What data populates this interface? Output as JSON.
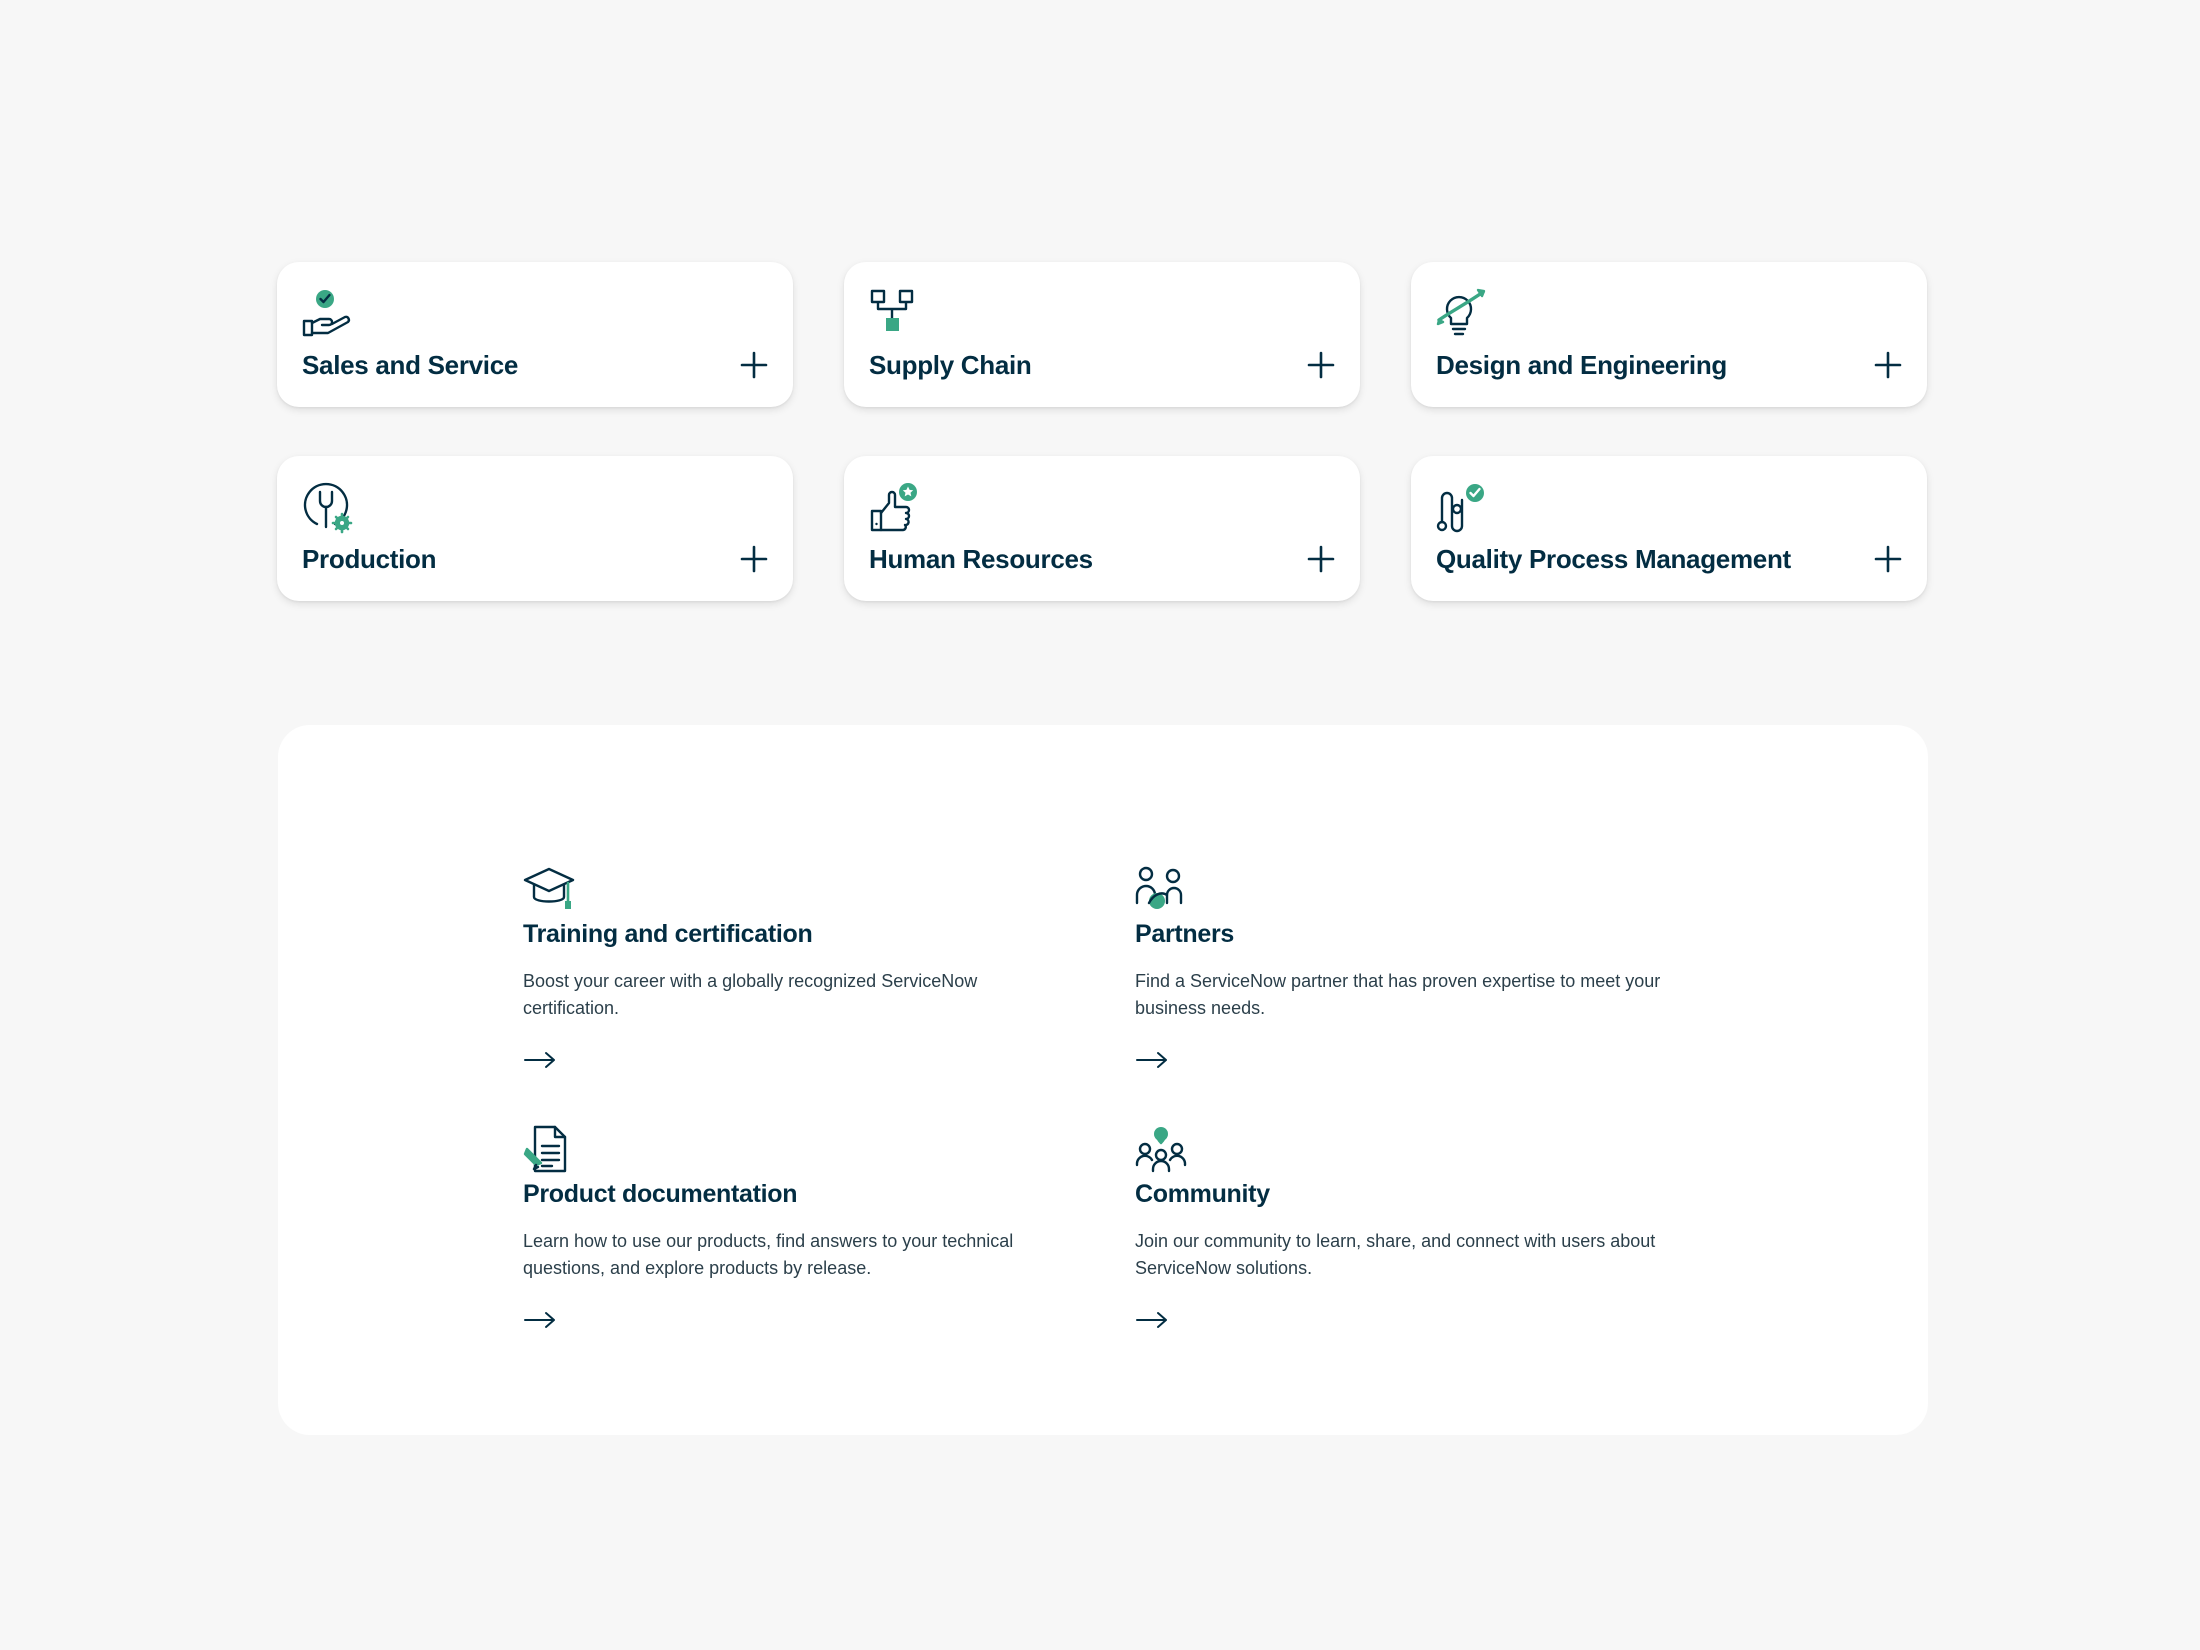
{
  "colors": {
    "page_background": "#f7f7f7",
    "card_background": "#ffffff",
    "heading_text": "#032d42",
    "body_text": "#2b3f4a",
    "accent_green": "#3aa785"
  },
  "solution_cards": [
    {
      "label": "Sales and Service",
      "icon": "hand-check-icon"
    },
    {
      "label": "Supply Chain",
      "icon": "network-nodes-icon"
    },
    {
      "label": "Design and Engineering",
      "icon": "lightbulb-planet-icon"
    },
    {
      "label": "Production",
      "icon": "wrench-gear-icon"
    },
    {
      "label": "Human Resources",
      "icon": "thumbs-up-star-icon"
    },
    {
      "label": "Quality Process Management",
      "icon": "process-path-check-icon"
    }
  ],
  "resources": [
    {
      "title": "Training and certification",
      "description": "Boost your career with a globally recognized ServiceNow certification.",
      "icon": "graduation-cap-icon"
    },
    {
      "title": "Partners",
      "description": "Find a ServiceNow partner that has proven expertise to meet your business needs.",
      "icon": "partners-handshake-icon"
    },
    {
      "title": "Product documentation",
      "description": "Learn how to use our products, find answers to your technical questions, and explore products by release.",
      "icon": "document-pencil-icon"
    },
    {
      "title": "Community",
      "description": "Join our community to learn, share, and connect with users about ServiceNow solutions.",
      "icon": "community-people-icon"
    }
  ]
}
